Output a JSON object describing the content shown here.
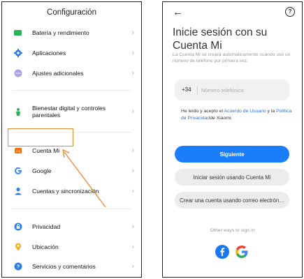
{
  "left": {
    "title": "Configuración",
    "items": [
      {
        "label": "Batería y rendimiento",
        "icon": "battery-icon"
      },
      {
        "label": "Aplicaciones",
        "icon": "apps-gear-icon"
      },
      {
        "label": "Ajustes adicionales",
        "icon": "more-dots-icon"
      },
      {
        "label": "Bienestar digital y controles parentales",
        "icon": "wellbeing-icon"
      },
      {
        "label": "Cuenta Mi",
        "icon": "mi-logo-icon"
      },
      {
        "label": "Google",
        "icon": "google-icon"
      },
      {
        "label": "Cuentas y sincronización",
        "icon": "person-icon"
      },
      {
        "label": "Privacidad",
        "icon": "privacy-icon"
      },
      {
        "label": "Ubicación",
        "icon": "location-pin-icon"
      },
      {
        "label": "Servicios y comentarios",
        "icon": "help-circle-icon"
      }
    ]
  },
  "right": {
    "title": "Inicie sesión con su Cuenta Mi",
    "description": "La Cuenta Mi se creará automáticamente cuando use un número de teléfono por primera vez.",
    "phone": {
      "prefix": "+34",
      "placeholder": "Número telefónico",
      "value": ""
    },
    "agreement": {
      "text1": "He leído y acepto el ",
      "link1": "Acuerdo de Usuario",
      "text2": " y la ",
      "link2": "Política de Privacidad",
      "text3": "de Xiaomi."
    },
    "buttons": {
      "next": "Siguiente",
      "login_mi": "Iniciar sesión usando Cuenta Mi",
      "create_email": "Crear una cuenta usando correo electrónico"
    },
    "other_ways": "Other ways to sign in",
    "social": [
      "facebook-icon",
      "google-icon"
    ]
  },
  "colors": {
    "accent": "#1a7dfa",
    "highlight": "#e58a32"
  }
}
